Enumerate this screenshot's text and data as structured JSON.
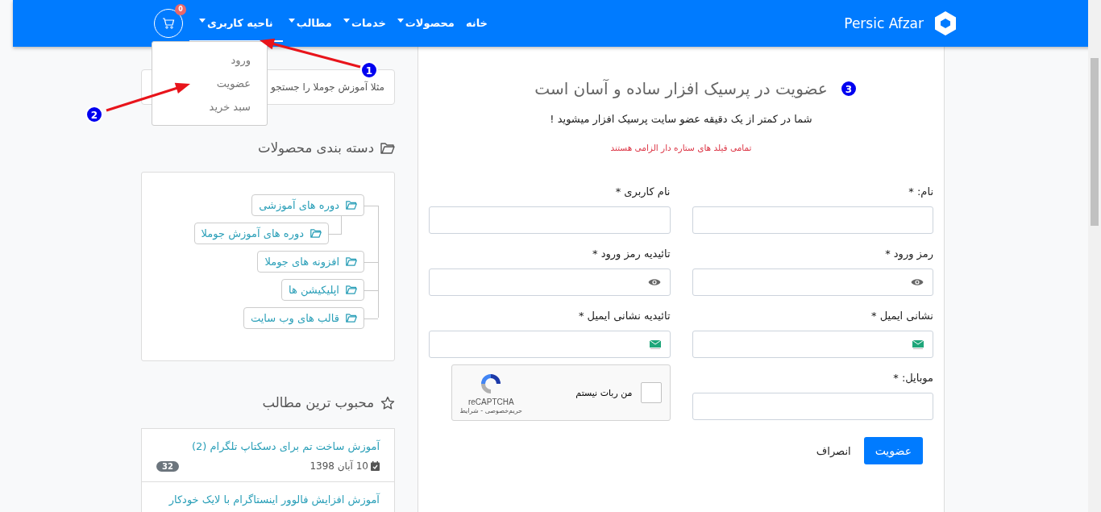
{
  "header": {
    "brand": "Persic Afzar",
    "nav": [
      {
        "label": "خانه",
        "dropdown": false,
        "selected": false
      },
      {
        "label": "محصولات",
        "dropdown": true,
        "selected": false
      },
      {
        "label": "خدمات",
        "dropdown": true,
        "selected": false
      },
      {
        "label": "مطالب",
        "dropdown": true,
        "selected": false
      },
      {
        "label": "ناحیه کاربری",
        "dropdown": true,
        "selected": true
      }
    ],
    "cart": {
      "count": "0"
    }
  },
  "user_menu": {
    "items": [
      "ورود",
      "عضویت",
      "سبد خرید"
    ]
  },
  "sidebar": {
    "search": {
      "placeholder": "مثلا آموزش جوملا را جستجو"
    },
    "categories": {
      "title": "دسته بندی محصولات",
      "tree": [
        {
          "label": "دوره های آموزشی",
          "children": [
            {
              "label": "دوره های آموزش جوملا"
            }
          ]
        },
        {
          "label": "افزونه های جوملا"
        },
        {
          "label": "اپلیکیشن ها"
        },
        {
          "label": "قالب های وب سایت"
        }
      ]
    },
    "popular": {
      "title": "محبوب ترین مطالب",
      "posts": [
        {
          "title": "آموزش ساخت تم برای دسکتاپ تلگرام (2)",
          "date": "10 آبان 1398",
          "hits": "32"
        },
        {
          "title": "آموزش افزایش فالوور اینستاگرام با لایک خودکار"
        }
      ]
    }
  },
  "form": {
    "title": "عضویت در پرسیک افزار ساده و آسان است",
    "subtitle": "شما در کمتر از یک دقیقه عضو سایت پرسیک افزار میشوید !",
    "required_note": "تمامی فیلد های ستاره دار الزامی هستند",
    "fields": [
      {
        "kind": "text",
        "label": "نام: *"
      },
      {
        "kind": "text",
        "label": "نام کاربری *"
      },
      {
        "kind": "password",
        "label": "رمز ورود *"
      },
      {
        "kind": "password",
        "label": "تائیدیه رمز ورود *"
      },
      {
        "kind": "email",
        "label": "نشانی ایمیل *"
      },
      {
        "kind": "email",
        "label": "تائیدیه نشانی ایمیل *"
      },
      {
        "kind": "text",
        "label": "موبایل: *"
      },
      {
        "kind": "captcha",
        "label": "من ربات نیستم",
        "checked": false,
        "brand": "reCAPTCHA",
        "terms": "حریم‌خصوصی - شرایط"
      }
    ],
    "submit": "عضویت",
    "cancel": "انصراف"
  },
  "annotations": [
    {
      "number": "1"
    },
    {
      "number": "2"
    },
    {
      "number": "3"
    }
  ]
}
